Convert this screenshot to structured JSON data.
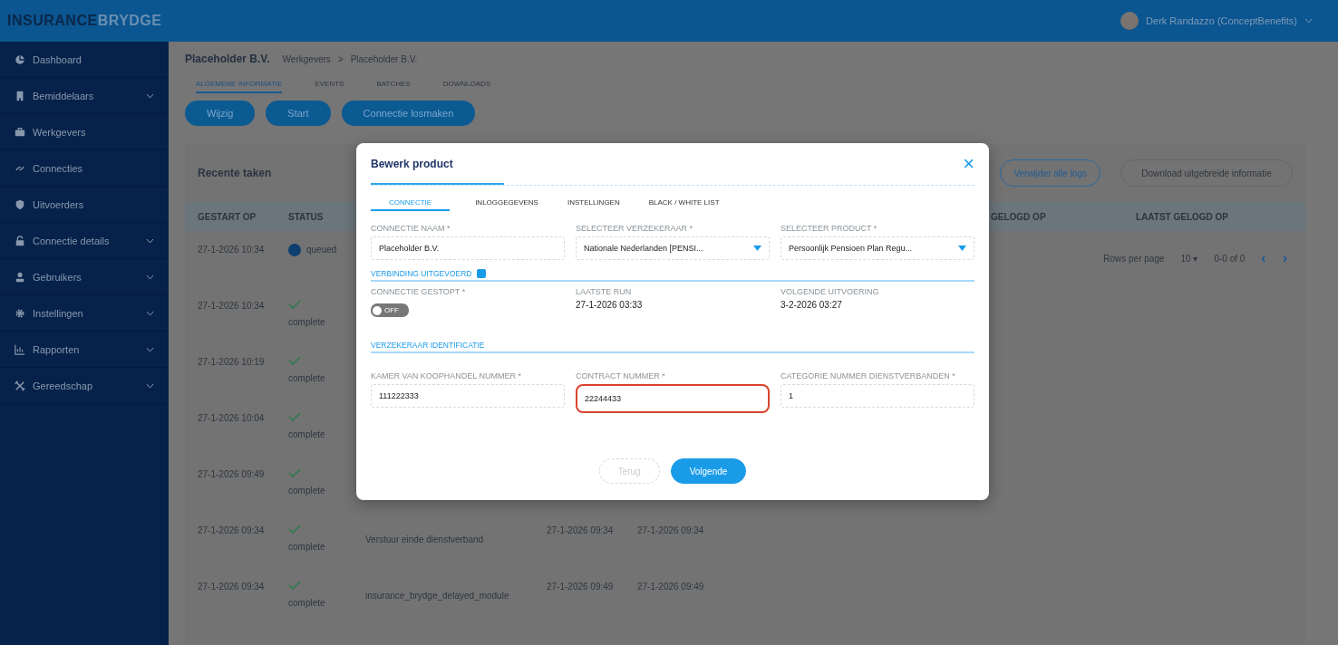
{
  "header": {
    "logo_part_1": "INSURANCE",
    "logo_part_2": "BRYDGE",
    "user": "Derk Randazzo (ConceptBenefits)"
  },
  "sidebar": {
    "items": [
      {
        "label": "Dashboard",
        "expandable": false
      },
      {
        "label": "Bemiddelaars",
        "expandable": true
      },
      {
        "label": "Werkgevers",
        "expandable": false
      },
      {
        "label": "Connecties",
        "expandable": false
      },
      {
        "label": "Uitvoerders",
        "expandable": false
      },
      {
        "label": "Connectie details",
        "expandable": true
      },
      {
        "label": "Gebruikers",
        "expandable": true
      },
      {
        "label": "Instellingen",
        "expandable": true
      },
      {
        "label": "Rapporten",
        "expandable": true
      },
      {
        "label": "Gereedschap",
        "expandable": true
      }
    ]
  },
  "page": {
    "title": "Placeholder B.V.",
    "breadcrumb": [
      "Werkgevers",
      ">",
      "Placeholder B.V."
    ],
    "tabs": [
      {
        "label": "ALGEMENE INFORMATIE",
        "selected": true
      },
      {
        "label": "EVENTS",
        "selected": false
      },
      {
        "label": "BATCHES",
        "selected": false
      },
      {
        "label": "DOWNLOADS",
        "selected": false
      }
    ],
    "buttons": [
      "Wijzig",
      "Start",
      "Connectie losmaken"
    ]
  },
  "recent_tasks": {
    "title": "Recente taken",
    "actions": [
      {
        "label": "Verwijder alle logs",
        "disabled": false
      },
      {
        "label": "Download uitgebreide informatie",
        "disabled": true
      }
    ],
    "columns": [
      "GESTART OP",
      "STATUS",
      "",
      "",
      ""
    ],
    "right_columns": [
      "GELOGD OP",
      "LAATST GELOGD OP"
    ],
    "rows": [
      {
        "started": "27-1-2026 10:34",
        "status": "queued",
        "kind": "queued",
        "task": "",
        "from": "",
        "to": ""
      },
      {
        "started": "27-1-2026 10:34",
        "status": "complete",
        "kind": "complete",
        "task": "",
        "from": "",
        "to": ""
      },
      {
        "started": "27-1-2026 10:19",
        "status": "complete",
        "kind": "complete",
        "task": "",
        "from": "",
        "to": ""
      },
      {
        "started": "27-1-2026 10:04",
        "status": "complete",
        "kind": "complete",
        "task": "",
        "from": "",
        "to": ""
      },
      {
        "started": "27-1-2026 09:49",
        "status": "complete",
        "kind": "complete",
        "task": "",
        "from": "",
        "to": ""
      },
      {
        "started": "27-1-2026 09:34",
        "status": "complete",
        "kind": "complete",
        "task": "Verstuur einde dienstverband",
        "from": "27-1-2026 09:34",
        "to": "27-1-2026 09:34"
      },
      {
        "started": "27-1-2026 09:34",
        "status": "complete",
        "kind": "complete",
        "task": "insurance_brydge_delayed_module",
        "from": "27-1-2026 09:49",
        "to": "27-1-2026 09:49"
      }
    ],
    "pagination": {
      "rows_label": "Rows per page",
      "rows_value": "10",
      "rows_caret": "▾",
      "range": "0-0 of 0",
      "prev": "‹",
      "next": "›"
    }
  },
  "modal": {
    "title": "Bewerk product",
    "close": "×",
    "progress": {
      "level": 0.22
    },
    "tabs": [
      {
        "label": "CONNECTIE",
        "selected": true
      },
      {
        "label": "INLOGGEGEVENS",
        "selected": false
      },
      {
        "label": "INSTELLINGEN",
        "selected": false
      },
      {
        "label": "BLACK / WHITE LIST",
        "selected": false
      }
    ],
    "fields": [
      {
        "label": "CONNECTIE NAAM *",
        "value": "Placeholder B.V.",
        "kind": "text"
      },
      {
        "label": "SELECTEER VERZEKERAAR *",
        "value": "Nationale Nederlanden [PENSI...",
        "kind": "select"
      },
      {
        "label": "SELECTEER PRODUCT *",
        "value": "Persoonlijk Pensioen Plan Regu...",
        "kind": "select"
      }
    ],
    "section_1": "VERBINDING UITGEVOERD",
    "stopped": {
      "label": "CONNECTIE GESTOPT *",
      "on": false,
      "toggle_text": "OFF"
    },
    "last_run": {
      "label": "LAATSTE RUN",
      "value": "27-1-2026 03:33"
    },
    "next_run": {
      "label": "VOLGENDE UITVOERING",
      "value": "3-2-2026 03:27"
    },
    "section_2": "VERZEKERAAR IDENTIFICATIE",
    "id_fields": [
      {
        "label": "KAMER VAN KOOPHANDEL NUMMER *",
        "value": "111222333",
        "highlighted": false
      },
      {
        "label": "CONTRACT NUMMER *",
        "value": "22244433",
        "highlighted": true
      },
      {
        "label": "CATEGORIE NUMMER DIENSTVERBANDEN *",
        "value": "1",
        "highlighted": false
      }
    ],
    "buttons": [
      {
        "label": "Terug",
        "disabled": true
      },
      {
        "label": "Volgende",
        "disabled": false
      }
    ]
  }
}
